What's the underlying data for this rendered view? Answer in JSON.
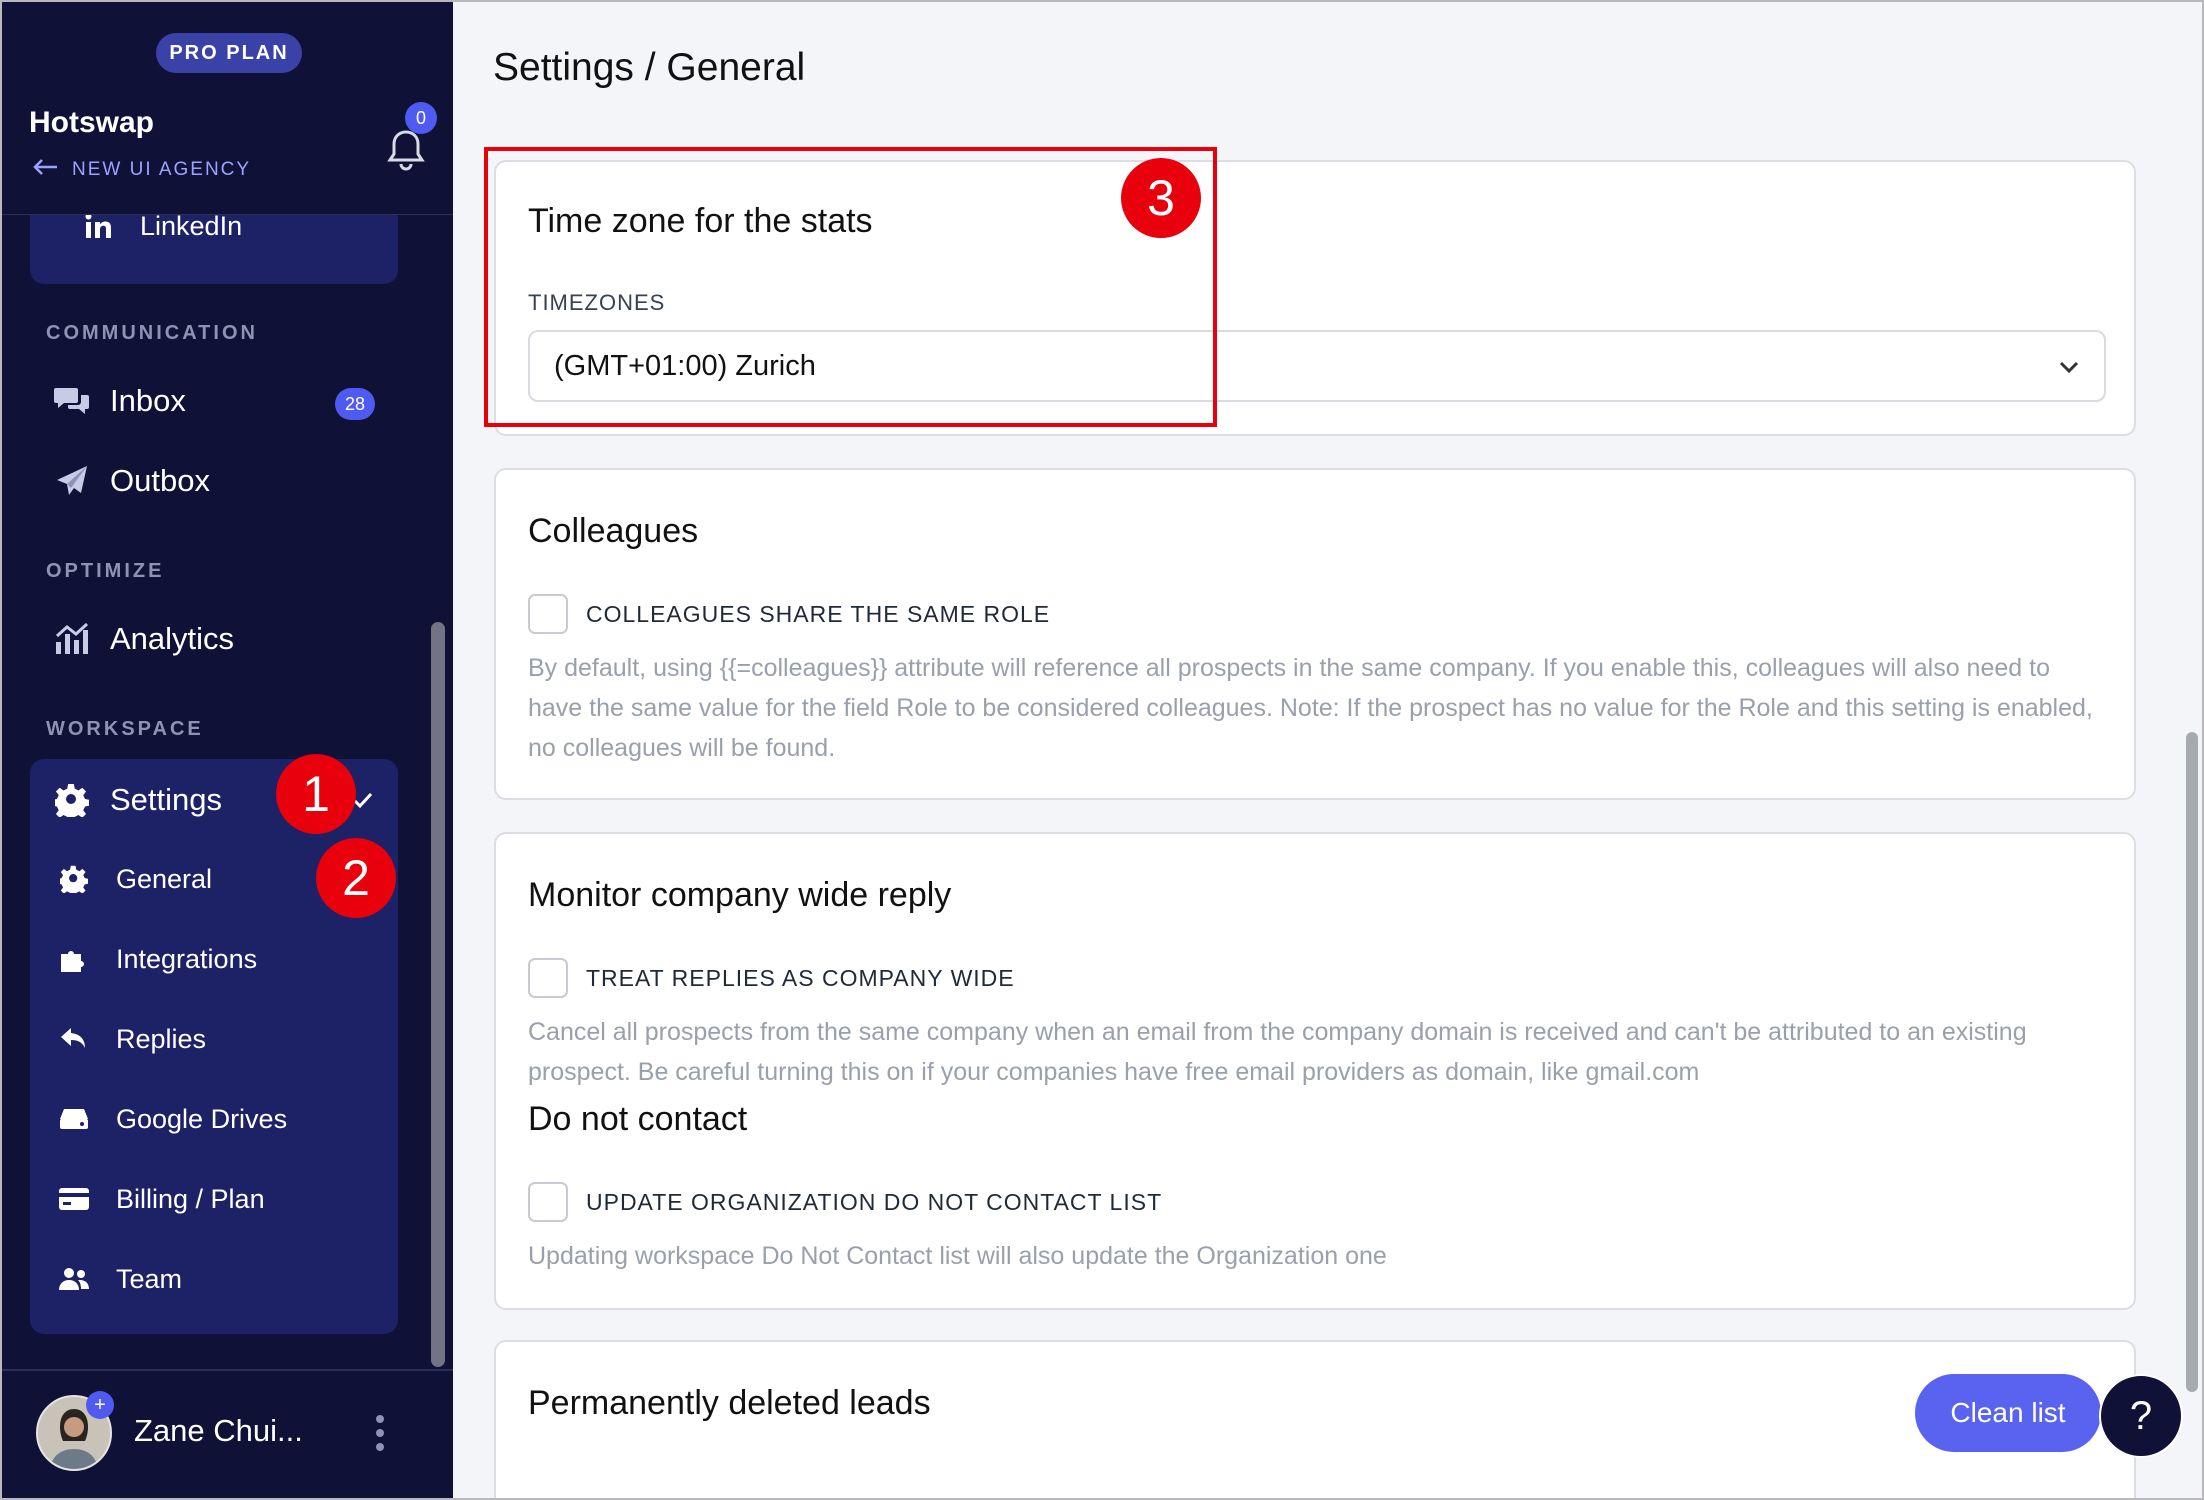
{
  "sidebar": {
    "plan_badge": "PRO PLAN",
    "workspace_name": "Hotswap",
    "agency_link": "NEW UI AGENCY",
    "notification_count": "0",
    "linkedin_label": "LinkedIn",
    "sections": {
      "communication": "COMMUNICATION",
      "optimize": "OPTIMIZE",
      "workspace": "WORKSPACE"
    },
    "inbox_label": "Inbox",
    "inbox_count": "28",
    "outbox_label": "Outbox",
    "analytics_label": "Analytics",
    "settings_label": "Settings",
    "settings_sub": [
      {
        "label": "General",
        "icon": "gear-icon"
      },
      {
        "label": "Integrations",
        "icon": "puzzle-icon"
      },
      {
        "label": "Replies",
        "icon": "reply-icon"
      },
      {
        "label": "Google Drives",
        "icon": "drive-icon"
      },
      {
        "label": "Billing / Plan",
        "icon": "credit-card-icon"
      },
      {
        "label": "Team",
        "icon": "team-icon"
      }
    ],
    "user_name": "Zane Chui...",
    "avatar_plus": "+"
  },
  "markers": {
    "one": "1",
    "two": "2",
    "three": "3"
  },
  "main": {
    "page_title": "Settings / General",
    "timezone_card": {
      "title": "Time zone for the stats",
      "field_label": "TIMEZONES",
      "selected": "(GMT+01:00) Zurich"
    },
    "colleagues_card": {
      "title": "Colleagues",
      "checkbox_label": "COLLEAGUES SHARE THE SAME ROLE",
      "help_text": "By default, using {{=colleagues}} attribute will reference all prospects in the same company. If you enable this, colleagues will also need to have the same value for the field Role to be considered colleagues. Note: If the prospect has no value for the Role and this setting is enabled, no colleagues will be found."
    },
    "monitor_card": {
      "title": "Monitor company wide reply",
      "checkbox_label": "TREAT REPLIES AS COMPANY WIDE",
      "help_text": "Cancel all prospects from the same company when an email from the company domain is received and can't be attributed to an existing prospect. Be careful turning this on if your companies have free email providers as domain, like gmail.com",
      "dnc_title": "Do not contact",
      "dnc_checkbox_label": "UPDATE ORGANIZATION DO NOT CONTACT LIST",
      "dnc_help_text": "Updating workspace Do Not Contact list will also update the Organization one"
    },
    "deleted_card": {
      "title": "Permanently deleted leads",
      "clean_button": "Clean list"
    },
    "help_button": "?"
  },
  "colors": {
    "sidebar_bg": "#0f1136",
    "sidebar_group_bg": "#1d2165",
    "accent": "#5a63f0",
    "annotation_red": "#e8000c"
  }
}
